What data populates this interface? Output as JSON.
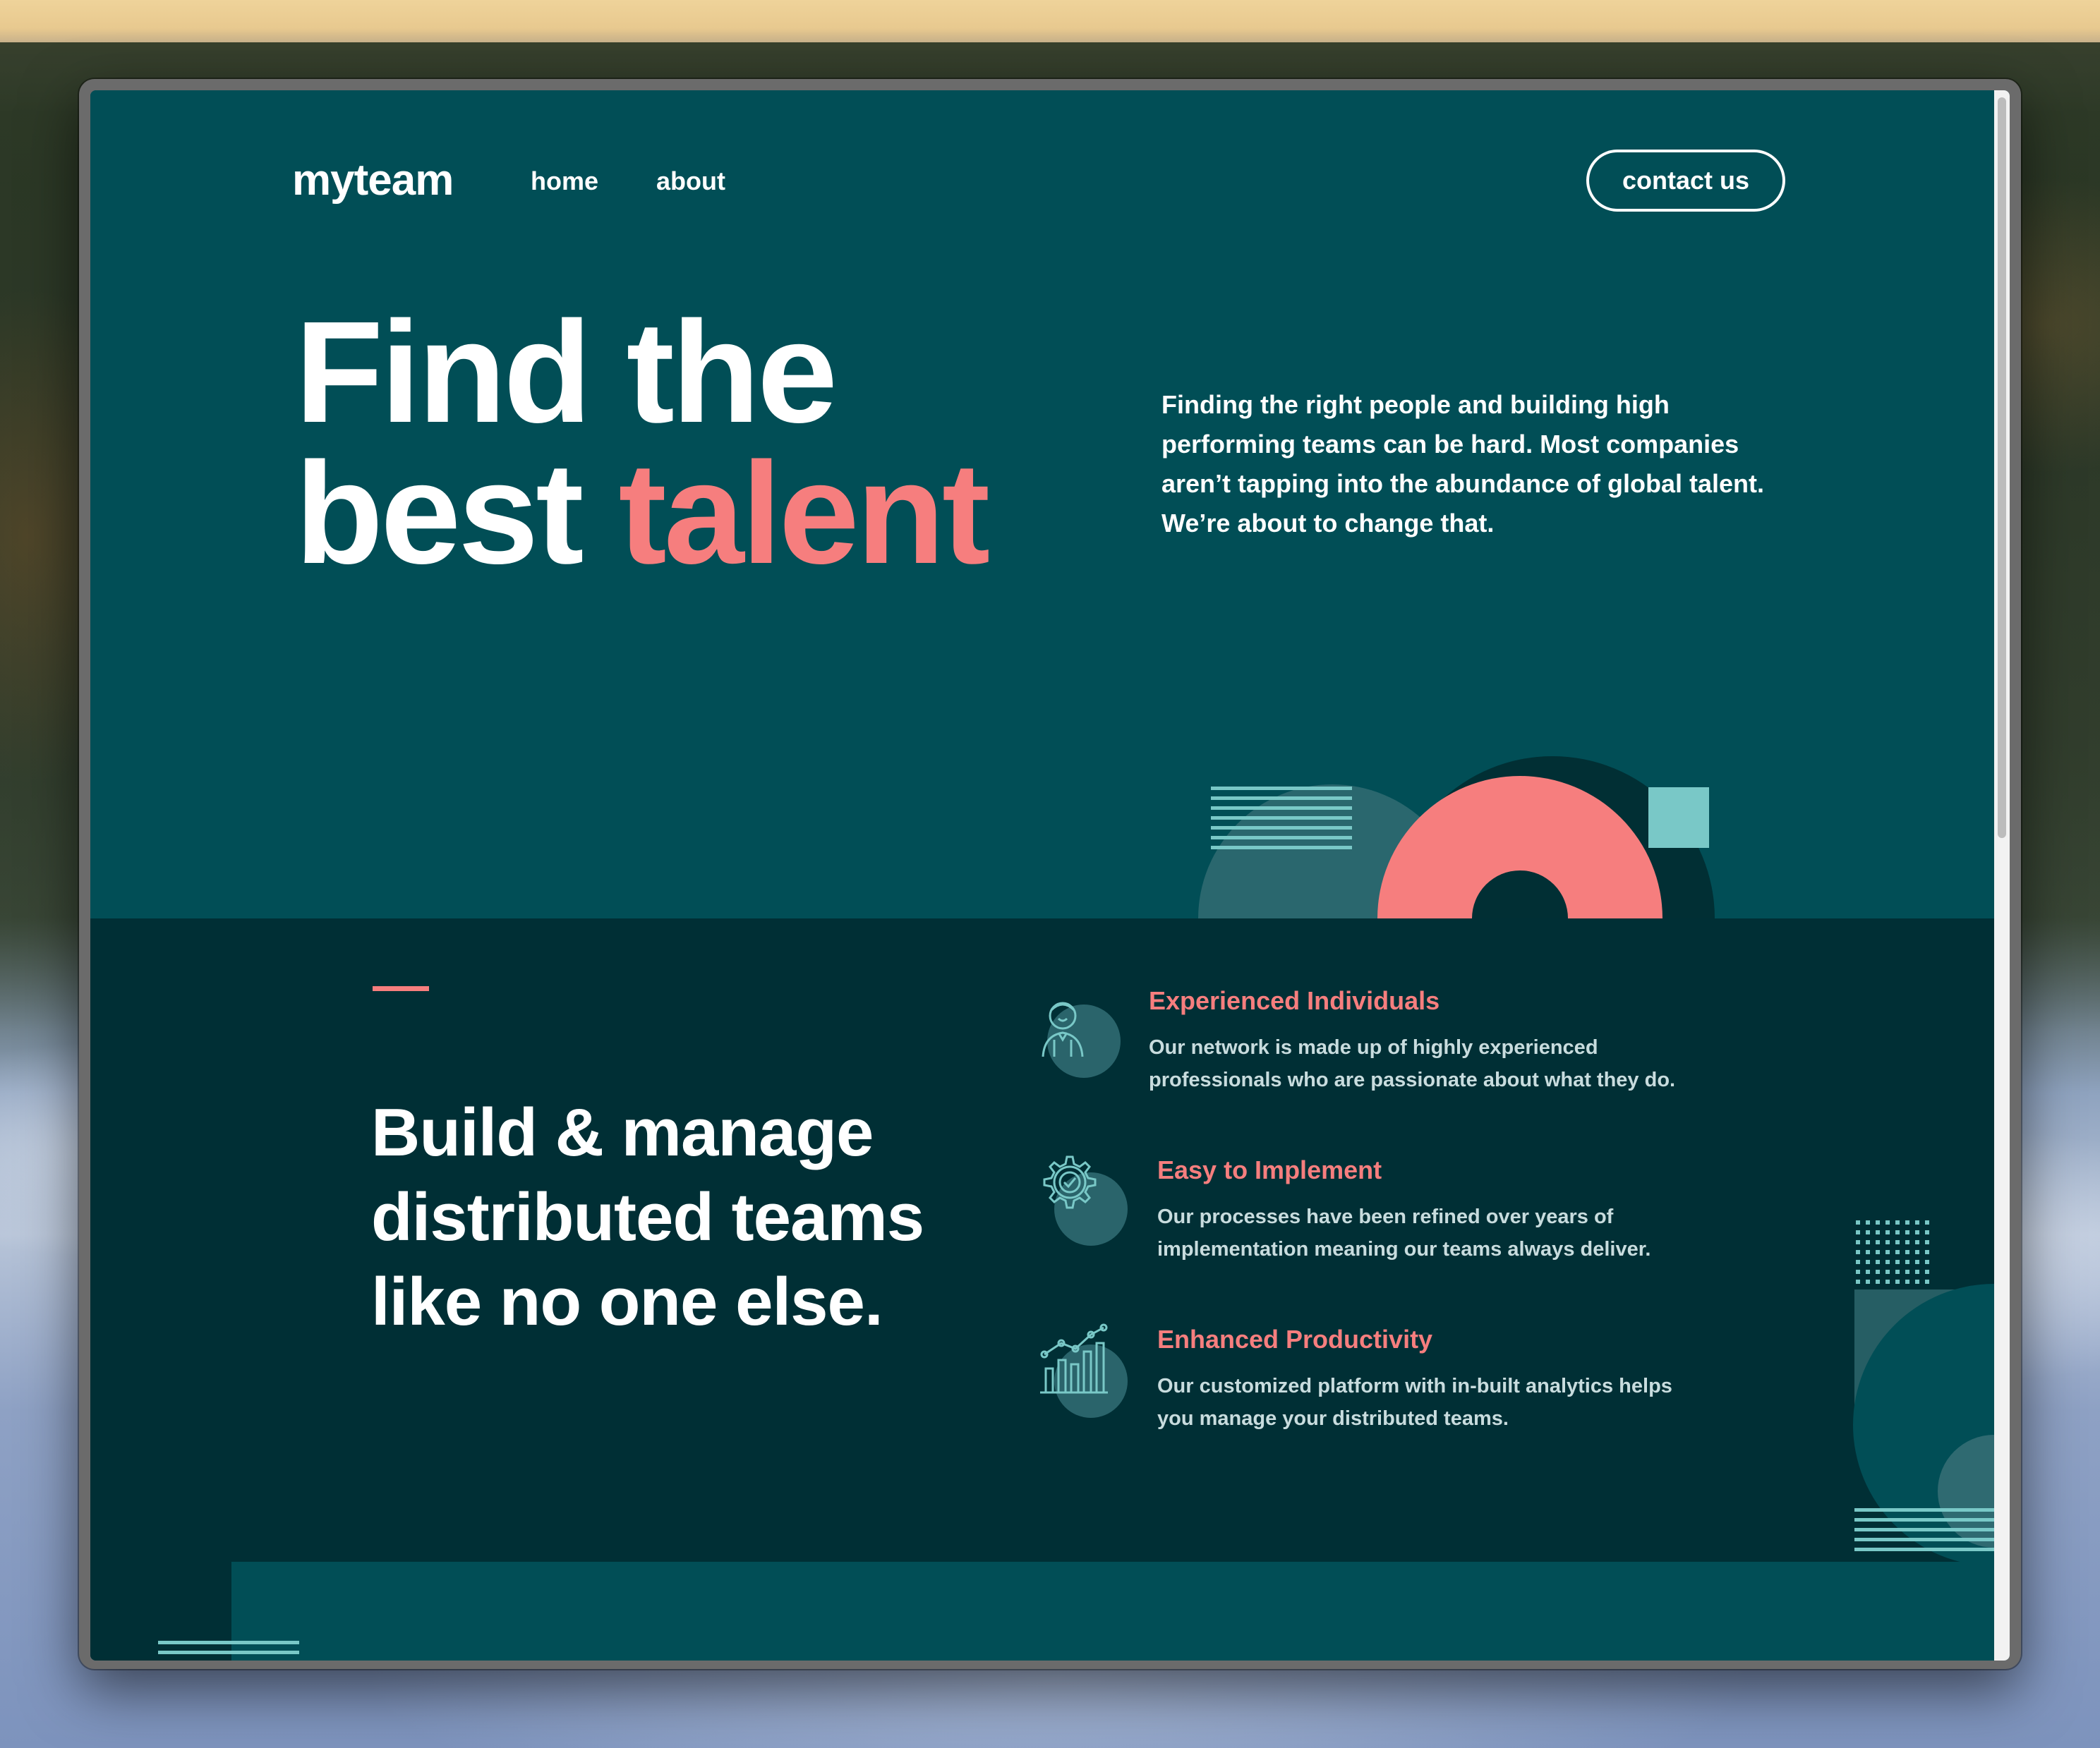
{
  "nav": {
    "logo": "myteam",
    "links": [
      {
        "label": "home"
      },
      {
        "label": "about"
      }
    ],
    "cta": "contact us"
  },
  "hero": {
    "title_line1": "Find the",
    "title_line2_plain": "best ",
    "title_line2_accent": "talent",
    "description": "Finding the right people and building high performing teams can be hard. Most companies aren’t tapping into the abundance of global talent. We’re about to change that."
  },
  "features": {
    "heading": "Build & manage distributed teams like no one else.",
    "items": [
      {
        "icon": "person-icon",
        "title": "Experienced Individuals",
        "text": "Our network is made up of highly experienced professionals who are passionate about what they do."
      },
      {
        "icon": "gear-check-icon",
        "title": "Easy to Implement",
        "text": "Our processes have been refined over years of implementation meaning our teams always deliver."
      },
      {
        "icon": "chart-icon",
        "title": "Enhanced Productivity",
        "text": "Our customized platform with in-built analytics helps you manage your distributed teams."
      }
    ]
  },
  "colors": {
    "hero_bg": "#014e56",
    "section_bg": "#002f35",
    "accent_coral": "#f67e7e",
    "accent_mint": "#79c8c7",
    "text_white": "#ffffff"
  }
}
